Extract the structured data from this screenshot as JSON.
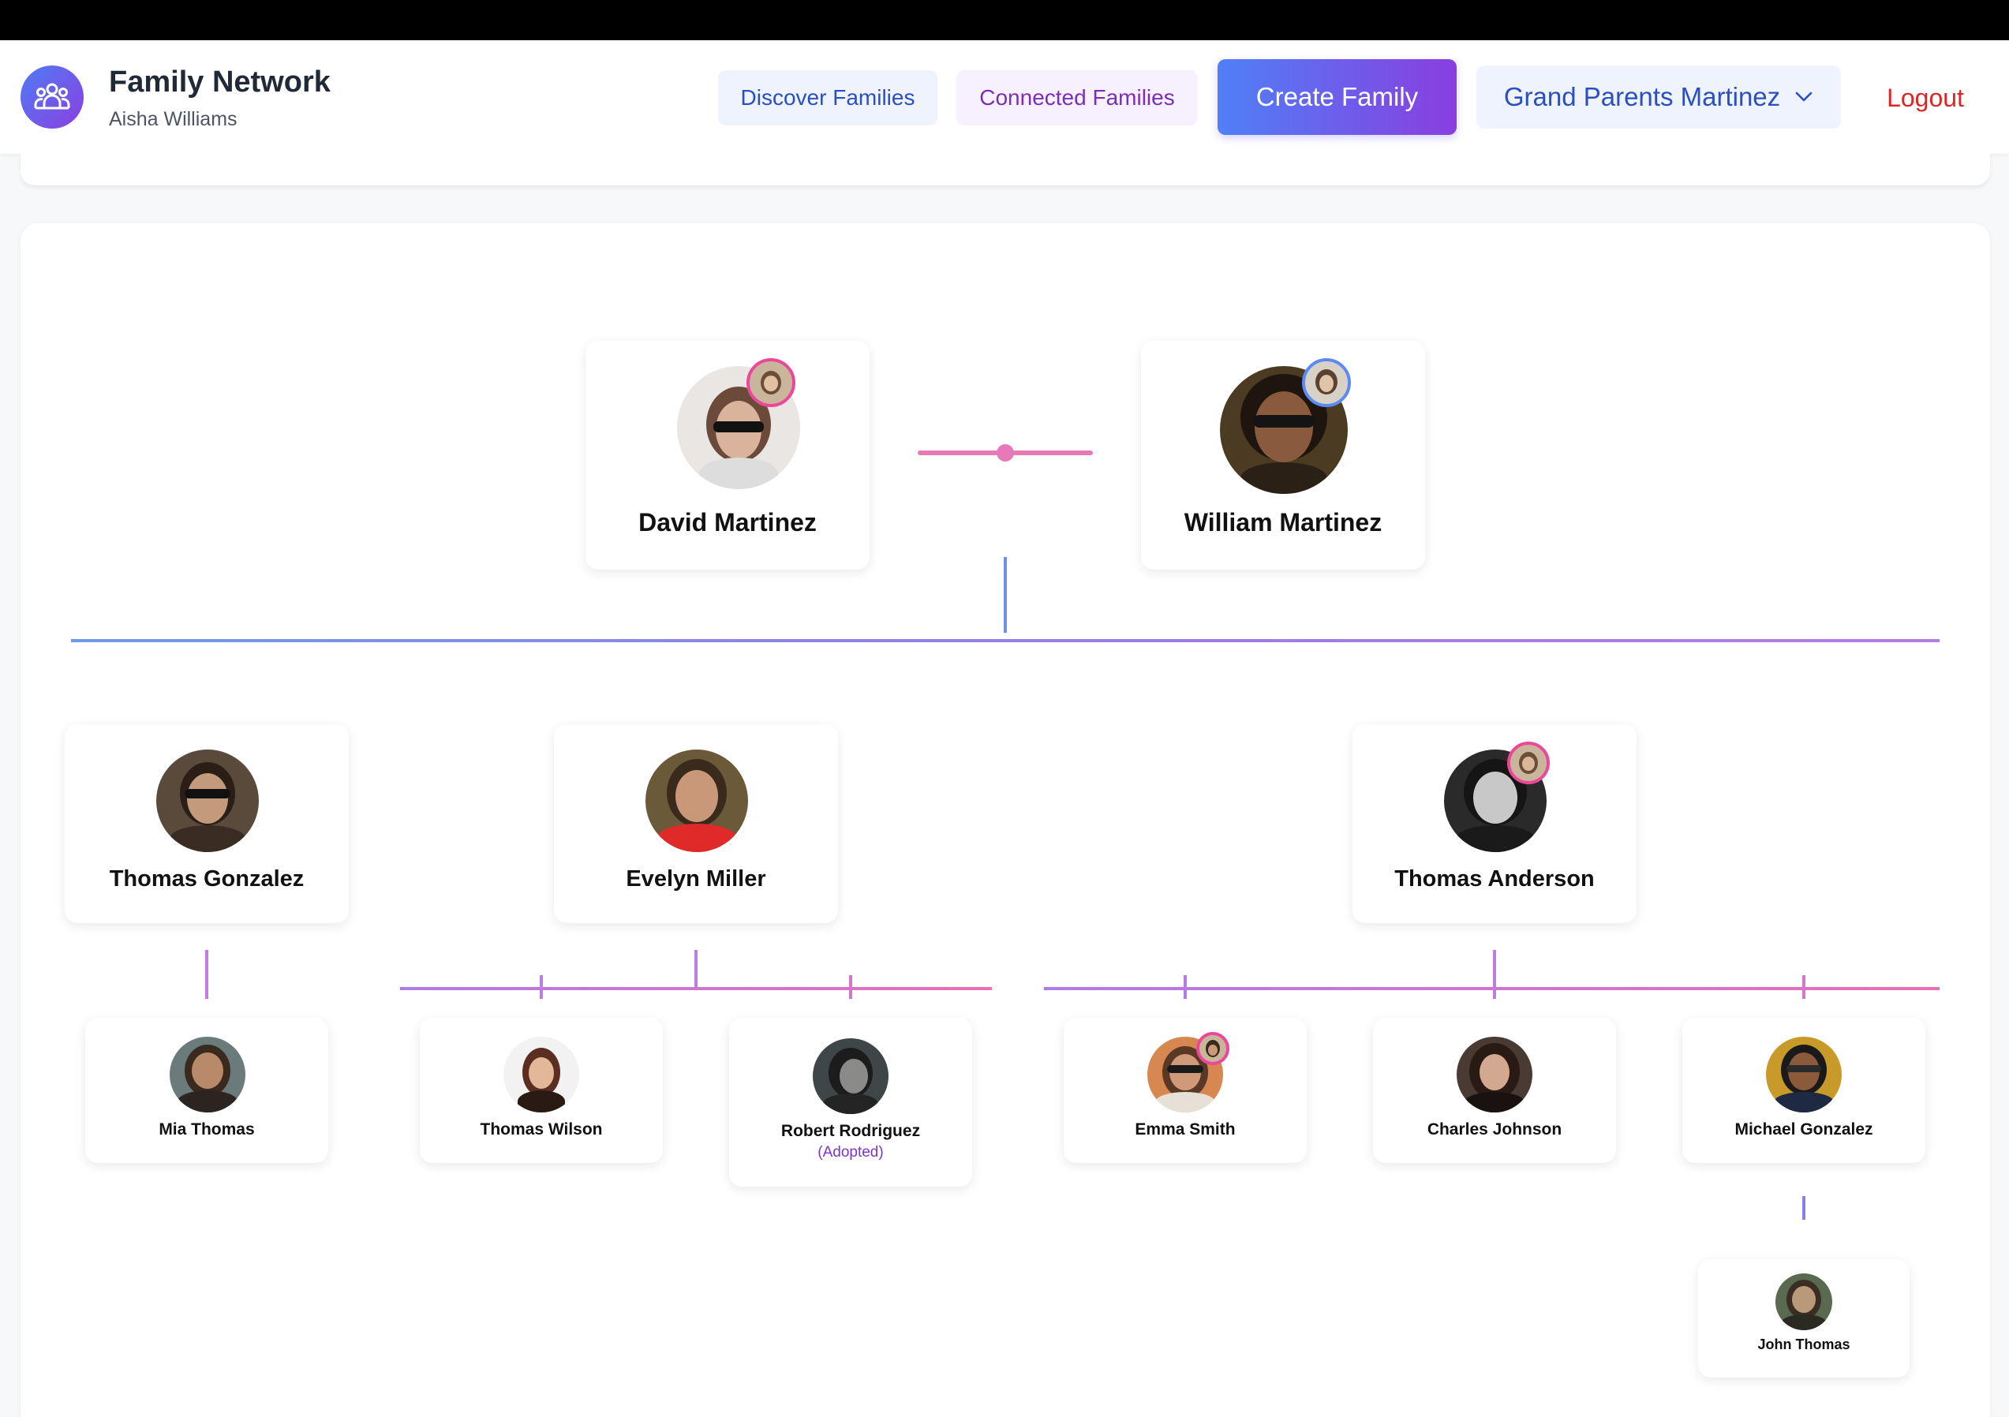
{
  "app": {
    "title": "Family Network",
    "user": "Aisha Williams",
    "logo_icon": "family-group-icon"
  },
  "nav": {
    "discover": "Discover Families",
    "connected": "Connected Families",
    "create": "Create Family",
    "current_family": "Grand Parents Martinez",
    "logout": "Logout"
  },
  "colors": {
    "accent_blue": "#4f80f6",
    "accent_purple": "#8a3ee0",
    "spouse_pink": "#e879b9",
    "logout_red": "#dc2626"
  },
  "tree": {
    "grandparents": {
      "left": "David Martinez",
      "right": "William Martinez"
    },
    "children": [
      {
        "name": "Thomas Gonzalez"
      },
      {
        "name": "Evelyn Miller"
      },
      {
        "name": "Thomas Anderson"
      }
    ],
    "grandchildren": [
      {
        "name": "Mia Thomas"
      },
      {
        "name": "Thomas Wilson"
      },
      {
        "name": "Robert Rodriguez",
        "note": "(Adopted)"
      },
      {
        "name": "Emma Smith"
      },
      {
        "name": "Charles Johnson"
      },
      {
        "name": "Michael Gonzalez"
      }
    ],
    "great_grandchildren": [
      {
        "name": "John Thomas"
      }
    ]
  }
}
